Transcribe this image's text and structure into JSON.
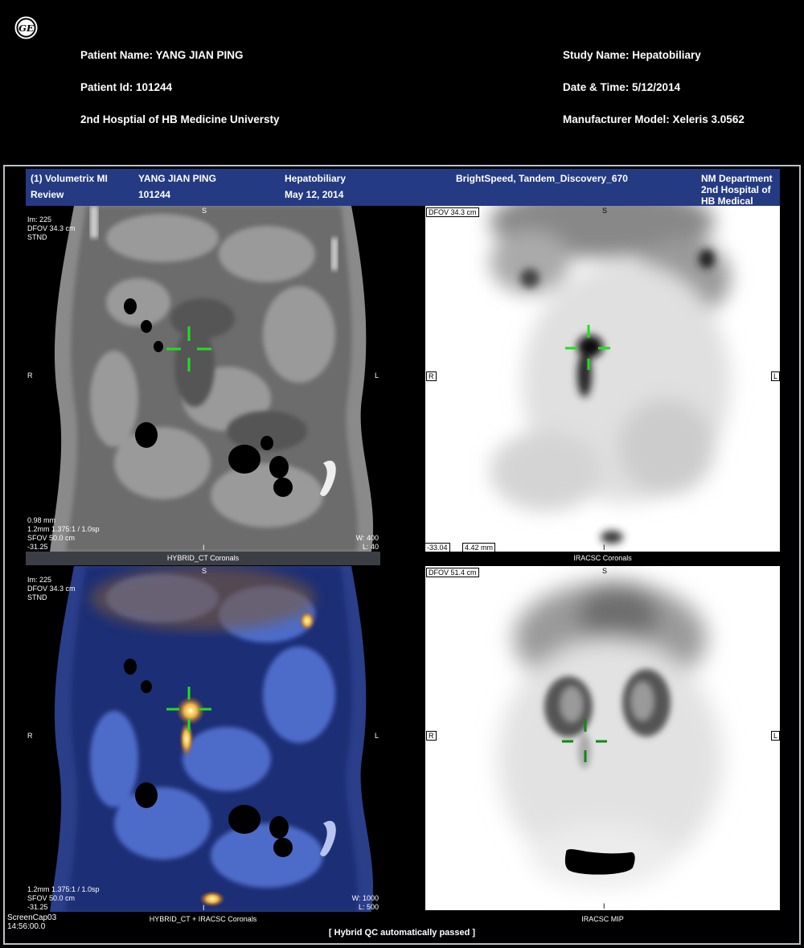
{
  "header": {
    "patient_name": "Patient Name: YANG JIAN PING",
    "patient_id": "Patient Id: 101244",
    "institution": "2nd Hosptial of HB Medicine Universty",
    "study_name": "Study Name: Hepatobiliary",
    "date_time": "Date & Time: 5/12/2014",
    "manufacturer_model": "Manufacturer Model: Xeleris 3.0562"
  },
  "banner": {
    "app_line1": "(1) Volumetrix MI",
    "app_line2": "Review",
    "patient_name": "YANG JIAN PING",
    "patient_id": "101244",
    "study": "Hepatobiliary",
    "date": "May 12, 2014",
    "scanner": "BrightSpeed, Tandem_Discovery_670",
    "dept_line1": "NM Department",
    "dept_line2": "2nd Hospital of",
    "dept_line3": "HB Medical"
  },
  "viewports": {
    "ct": {
      "label": "HYBRID_CT Coronals",
      "info": [
        "Im: 225",
        "DFOV 34.3 cm",
        "STND"
      ],
      "bottom_info": [
        "0.98 mm",
        "1.2mm 1.375:1 / 1.0sp",
        "SFOV 50.0 cm",
        "-31.25"
      ],
      "window": "W: 400",
      "level": "L: 40",
      "ori_top": "S",
      "ori_left": "R",
      "ori_right": "L",
      "ori_bottom": "I"
    },
    "pet": {
      "label": "IRACSC Coronals",
      "dfov": "DFOV 34.3 cm",
      "bottom_left": "-33.04",
      "bottom_mm": "4.42 mm",
      "ori_top": "S",
      "ori_left": "R",
      "ori_right": "L",
      "ori_bottom": "I"
    },
    "fusion": {
      "label": "HYBRID_CT + IRACSC Coronals",
      "info": [
        "Im: 225",
        "DFOV 34.3 cm",
        "STND"
      ],
      "bottom_info": [
        "1.2mm 1.375:1 / 1.0sp",
        "SFOV 50.0 cm",
        "-31.25"
      ],
      "window": "W: 1000",
      "level": "L: 500",
      "ori_top": "S",
      "ori_left": "R",
      "ori_right": "L",
      "ori_bottom": "I"
    },
    "mip": {
      "label": "IRACSC MIP",
      "dfov": "DFOV 51.4 cm",
      "ori_top": "S",
      "ori_left": "R",
      "ori_right": "L",
      "ori_bottom": "I"
    }
  },
  "screencap": {
    "name": "ScreenCap03",
    "time": "14:56:00.0"
  },
  "qc_status": "[ Hybrid QC automatically passed ]",
  "colors": {
    "banner": "#243a82",
    "crosshair": "#22dd22",
    "label_bar": "#3b3f45"
  }
}
